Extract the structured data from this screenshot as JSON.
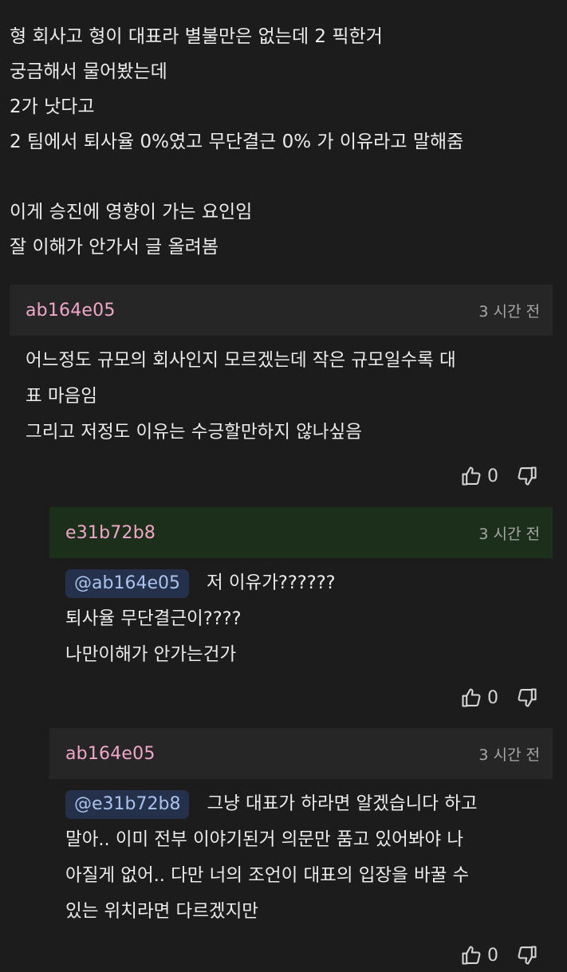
{
  "post": {
    "lines": [
      "형 회사고 형이 대표라 별불만은 없는데 2 픽한거",
      "궁금해서 물어봤는데",
      "2가 낫다고",
      "2 팀에서 퇴사율 0%였고 무단결근 0% 가 이유라고 말해줌",
      "",
      "이게 승진에 영향이 가는 요인임",
      "잘 이해가 안가서 글 올려봄"
    ]
  },
  "comments": [
    {
      "nick": "ab164e05",
      "time": "3 시간 전",
      "mention": "",
      "lines": [
        "어느정도 규모의 회사인지 모르겠는데 작은 규모일수록 대",
        "표 마음임",
        "그리고 저정도 이유는 수긍할만하지 않나싶음"
      ],
      "likes": "0"
    },
    {
      "nick": "e31b72b8",
      "time": "3 시간 전",
      "mention": "@ab164e05",
      "lines": [
        "저 이유가??????",
        "퇴사율 무단결근이????",
        "나만이해가 안가는건가"
      ],
      "likes": "0"
    },
    {
      "nick": "ab164e05",
      "time": "3 시간 전",
      "mention": "@e31b72b8",
      "lines": [
        "그냥 대표가 하라면 알겠습니다 하고",
        "말아.. 이미 전부 이야기된거 의문만 품고 있어봐야 나",
        "아질게 없어.. 다만 너의 조언이 대표의 입장을 바꿀 수",
        "있는 위치라면 다르겠지만"
      ],
      "likes": "0"
    }
  ],
  "icons": {
    "like": "thumbs-up-icon",
    "dislike": "thumbs-down-icon"
  },
  "colors": {
    "background": "#1c1c1c",
    "nickname": "#f0a7c8",
    "mention_bg": "#25304a",
    "mention_text": "#a9c3ee",
    "highlight_header": "#1c2f1a"
  }
}
